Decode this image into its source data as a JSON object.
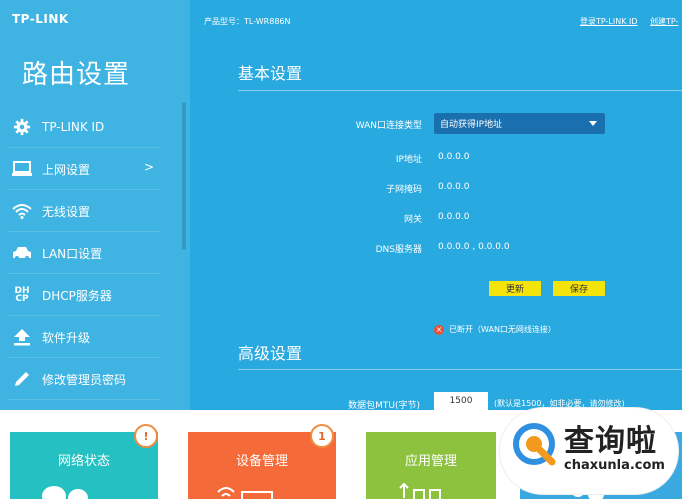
{
  "brand": "TP-LINK",
  "sidebar": {
    "title": "路由设置",
    "items": [
      {
        "label": "TP-LINK ID",
        "icon": "gear-icon"
      },
      {
        "label": "上网设置",
        "icon": "monitor-icon",
        "chevron": ">"
      },
      {
        "label": "无线设置",
        "icon": "wifi-icon"
      },
      {
        "label": "LAN口设置",
        "icon": "car-icon"
      },
      {
        "label": "DHCP服务器",
        "icon": "dhcp-icon",
        "icon_text_1": "DH",
        "icon_text_2": "CP"
      },
      {
        "label": "软件升级",
        "icon": "upload-icon"
      },
      {
        "label": "修改管理员密码",
        "icon": "pencil-icon"
      }
    ]
  },
  "header": {
    "model": "产品型号：TL-WR886N",
    "login_link": "登录TP-LINK ID",
    "create_link": "创建TP-"
  },
  "basic": {
    "title": "基本设置",
    "wan_type_label": "WAN口连接类型",
    "wan_type_value": "自动获得IP地址",
    "ip_label": "IP地址",
    "ip_value": "0.0.0.0",
    "mask_label": "子网掩码",
    "mask_value": "0.0.0.0",
    "gateway_label": "网关",
    "gateway_value": "0.0.0.0",
    "dns_label": "DNS服务器",
    "dns_value": "0.0.0.0 , 0.0.0.0",
    "refresh_label": "更新",
    "save_label": "保存",
    "status_icon": "×",
    "status_text": "已断开（WAN口无网线连接）"
  },
  "advanced": {
    "title": "高级设置",
    "mtu_label": "数据包MTU(字节)",
    "mtu_value": "1500",
    "mtu_hint": "(默认是1500，如非必要，请勿修改)"
  },
  "tiles": [
    {
      "label": "网络状态",
      "badge": "!"
    },
    {
      "label": "设备管理",
      "badge": "1"
    },
    {
      "label": "应用管理"
    },
    {
      "label": ""
    }
  ],
  "watermark": {
    "text": "查询啦",
    "sub": "chaxunla.com"
  },
  "colors": {
    "sidebar": "#3fb4e2",
    "main": "#28a9df",
    "select": "#1a6fae",
    "button": "#f5e30c",
    "tile_teal": "#25c0c2",
    "tile_orange": "#f46b39",
    "tile_green": "#8dc23f",
    "tile_blue": "#3aa9e0"
  }
}
